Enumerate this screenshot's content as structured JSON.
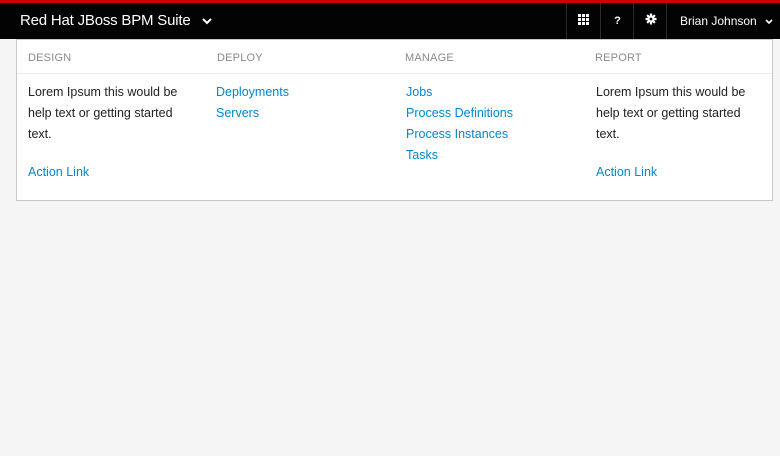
{
  "header": {
    "brand": "Red Hat JBoss BPM Suite",
    "help_label": "?",
    "user_name": "Brian Johnson",
    "accent_color": "#cc0000"
  },
  "menu": {
    "design": {
      "heading": "DESIGN",
      "help_text": "Lorem Ipsum this would be help text or getting started text.",
      "action_link": "Action Link"
    },
    "deploy": {
      "heading": "DEPLOY",
      "links": [
        "Deployments",
        "Servers"
      ]
    },
    "manage": {
      "heading": "MANAGE",
      "links": [
        "Jobs",
        "Process Definitions",
        "Process Instances",
        "Tasks"
      ]
    },
    "report": {
      "heading": "REPORT",
      "help_text": "Lorem Ipsum this would be help text or getting started text.",
      "action_link": "Action Link"
    }
  },
  "icons": {
    "brand_caret": "chevron-down-icon",
    "apps": "grid-icon",
    "settings": "gear-icon",
    "user_caret": "chevron-down-icon"
  }
}
